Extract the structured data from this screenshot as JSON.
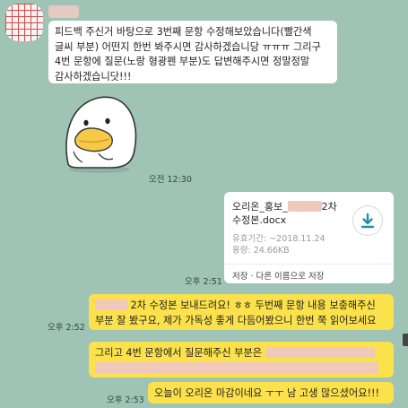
{
  "messages": {
    "m1": {
      "text": "피드백 주신거 바탕으로 3번째 문항 수정해보았습니다(빨간색 글씨 부분) 어떤지 한번 봐주시면 감사하겠습니당 ㅠㅠㅠ 그리구 4번 문항에 질문(노랑 형광펜 부분)도 답변해주시면 정말정말 감사하겠습니닷!!!"
    },
    "t_sticker": "오전 12:30",
    "file": {
      "name_prefix": "오리온_홍보_",
      "name_suffix": "2차",
      "name_line2": "수정본.docx",
      "validity_label": "유효기간:",
      "validity_value": "~2018.11.24",
      "size_label": "용량:",
      "size_value": "24.66KB",
      "action_save": "저장",
      "action_separator": " · ",
      "action_save_as": "다른 이름으로 저장"
    },
    "t_file": "오후 2:51",
    "m2": {
      "line1": " 2차 수정본 보내드려요! ㅎㅎ 두번째 문항 내용 보충해주신",
      "line2": "부분 잘 봤구요, 제가 가독성 좋게 다듬어봤으니 한번 쭉 읽어보세요"
    },
    "t_m2": "오후 2:52",
    "m3": {
      "text": "그리고 4번 문항에서 질문해주신 부분은"
    },
    "m4": {
      "text": "오늘이 오리온 마감이네요 ㅜㅜ 남 고생 많으셨어요!!!"
    },
    "t_m4": "오후 2:53"
  }
}
